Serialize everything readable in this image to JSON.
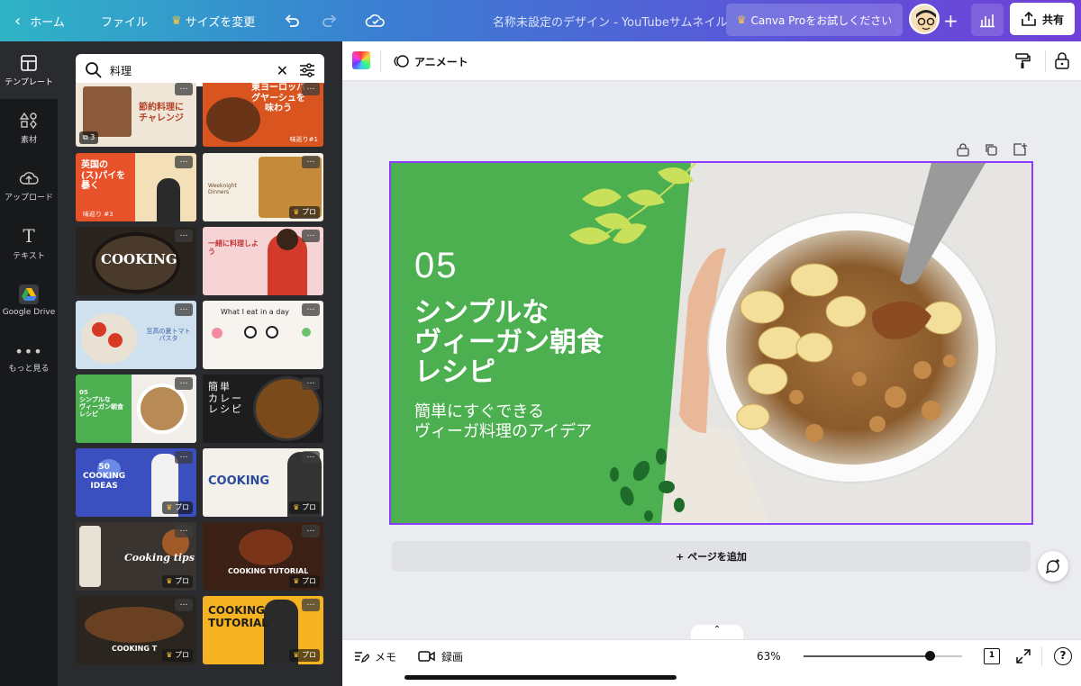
{
  "topbar": {
    "home": "ホーム",
    "file": "ファイル",
    "resize": "サイズを変更",
    "title": "名称未設定のデザイン - YouTubeサムネイル",
    "canva_pro": "Canva Proをお試しください",
    "share": "共有"
  },
  "rail": [
    {
      "label": "テンプレート",
      "icon": "template-icon"
    },
    {
      "label": "素材",
      "icon": "elements-icon"
    },
    {
      "label": "アップロード",
      "icon": "upload-icon"
    },
    {
      "label": "テキスト",
      "icon": "text-icon"
    },
    {
      "label": "Google Drive",
      "icon": "google-drive-icon"
    },
    {
      "label": "もっと見る",
      "icon": "more-icon"
    }
  ],
  "search": {
    "value": "料理"
  },
  "templates": [
    {
      "text": "節約料理に\nチャレンジ",
      "badge": "3",
      "more": "…",
      "bg": "#f0e6d8"
    },
    {
      "text": "東ヨーロッパ\nグヤーシュを\n味わう",
      "badge": "味巡り#1",
      "more": "…",
      "bg": "#d9541e"
    },
    {
      "text": "英国の\n(ス)パイを\n暴く",
      "badge": "味巡り #3",
      "more": "…",
      "bg": "#e8522b"
    },
    {
      "text": "Weeknight Dinners",
      "badge": "プロ",
      "more": "…",
      "bg": "#f3ede2"
    },
    {
      "text": "COOKING",
      "badge": "",
      "more": "…",
      "bg": "#2a241f"
    },
    {
      "text": "一緒に料理しよう",
      "badge": "",
      "more": "…",
      "bg": "#f6d3d4"
    },
    {
      "text": "至高の夏トマトパスタ",
      "badge": "",
      "more": "…",
      "bg": "#cfe0ef"
    },
    {
      "text": "What I eat in a day",
      "badge": "",
      "more": "…",
      "bg": "#f7f4f0"
    },
    {
      "text": "05\nシンプルな\nヴィーガン朝食\nレシピ",
      "badge": "",
      "more": "…",
      "bg": "#4caf50"
    },
    {
      "text": "簡単\nカレー\nレシピ",
      "badge": "",
      "more": "…",
      "bg": "#1d1d1d"
    },
    {
      "text": "50\nCOOKING\nIDEAS",
      "badge": "プロ",
      "more": "…",
      "bg": "#3b4fbf"
    },
    {
      "text": "COOKING",
      "badge": "プロ",
      "more": "…",
      "bg": "#f4f1ea"
    },
    {
      "text": "Cooking tips",
      "badge": "プロ",
      "more": "…",
      "bg": "#3a3430"
    },
    {
      "text": "COOKING TUTORIAL",
      "badge": "プロ",
      "more": "…",
      "bg": "#3a2015"
    },
    {
      "text": "COOKING T",
      "badge": "プロ",
      "more": "…",
      "bg": "#2b2520"
    },
    {
      "text": "COOKING\nTUTORIAL",
      "badge": "プロ",
      "more": "…",
      "bg": "#f5b321"
    }
  ],
  "toolbar": {
    "animate": "アニメート"
  },
  "design": {
    "number": "05",
    "title": "シンプルな\nヴィーガン朝食\nレシピ",
    "subtitle": "簡単にすぐできる\nヴィーガ料理のアイデア",
    "green": "#4caf50"
  },
  "editor": {
    "add_page": "+ ページを追加"
  },
  "bottombar": {
    "memo": "メモ",
    "record": "録画",
    "zoom": "63%",
    "zoom_value": 0.63,
    "page": "1"
  },
  "colors": {
    "accent": "#8b3dff",
    "canvas_green": "#4caf50"
  }
}
